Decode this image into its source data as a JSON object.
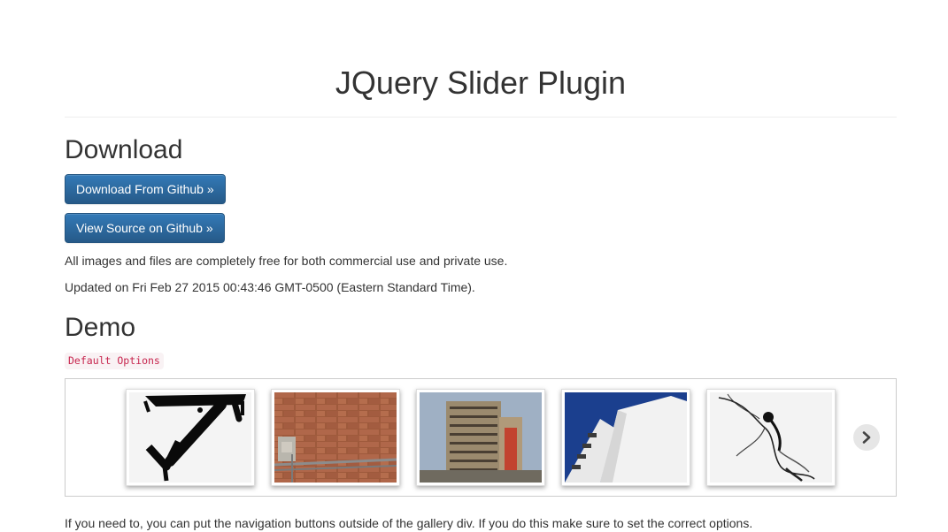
{
  "header": {
    "title": "JQuery Slider Plugin"
  },
  "download": {
    "heading": "Download",
    "download_button": "Download From Github »",
    "source_button": "View Source on Github »",
    "license_text": "All images and files are completely free for both commercial use and private use.",
    "updated_text": "Updated on Fri Feb 27 2015 00:43:46 GMT-0500 (Eastern Standard Time)."
  },
  "demo": {
    "heading": "Demo",
    "code_label": "Default Options",
    "gallery": {
      "thumbnails": [
        {
          "name": "graffiti-arrow-image"
        },
        {
          "name": "brick-wall-image"
        },
        {
          "name": "apartment-tower-image"
        },
        {
          "name": "white-building-sky-image"
        },
        {
          "name": "ink-in-water-image"
        }
      ],
      "next_icon": "chevron-right-icon"
    },
    "note_text": "If you need to, you can put the navigation buttons outside of the gallery div. If you do this make sure to set the correct options."
  },
  "colors": {
    "button_primary": "#337ab7",
    "code_text": "#c7254e",
    "code_bg": "#f9f2f4"
  }
}
